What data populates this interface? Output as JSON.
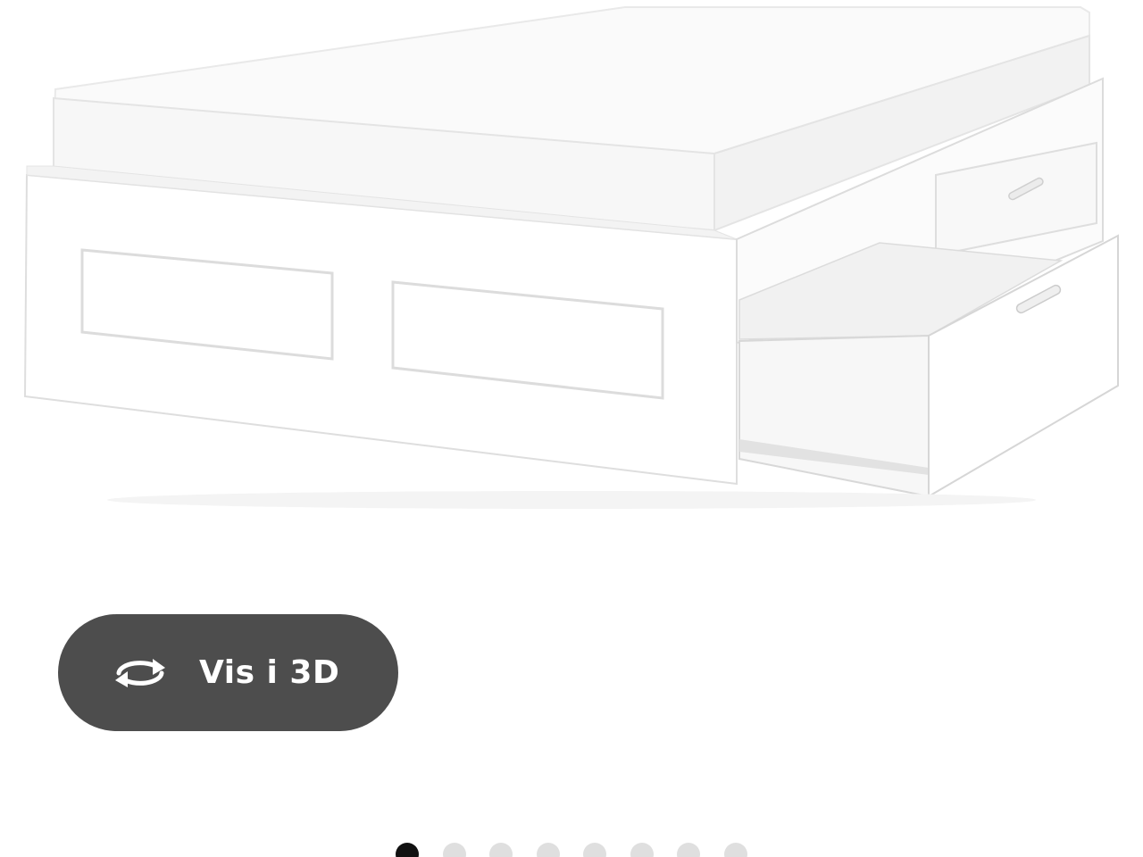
{
  "product_image": {
    "alt": "",
    "colors": {
      "frame": "#ffffff",
      "mattress": "#f6f6f6",
      "shadow": "#e6e6e6"
    }
  },
  "view_3d_button": {
    "label": "Vis i 3D",
    "icon": "rotate-3d-icon",
    "background": "#4d4d4d",
    "text_color": "#ffffff"
  },
  "pagination": {
    "total": 8,
    "current": 1,
    "active_color": "#111111",
    "inactive_color": "#dfdfdf"
  }
}
